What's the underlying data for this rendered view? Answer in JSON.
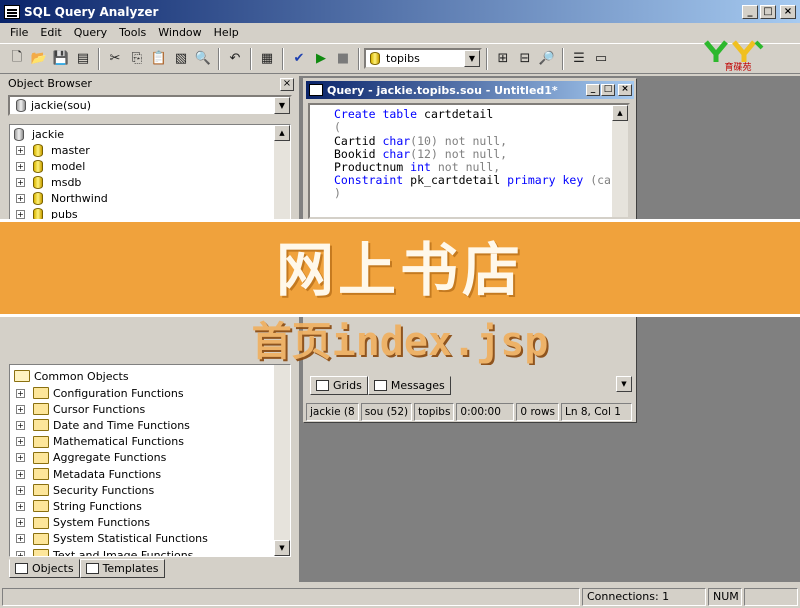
{
  "window": {
    "title": "SQL Query Analyzer",
    "controls": [
      "_",
      "□",
      "×"
    ]
  },
  "menu": [
    "File",
    "Edit",
    "Query",
    "Tools",
    "Window",
    "Help"
  ],
  "toolbar": {
    "database": "topibs"
  },
  "object_browser": {
    "title": "Object Browser",
    "server": "jackie(sou)",
    "tree_root": "jackie",
    "databases": [
      "master",
      "model",
      "msdb",
      "Northwind",
      "pubs"
    ],
    "common_objects_label": "Common Objects",
    "functions": [
      "Configuration Functions",
      "Cursor Functions",
      "Date and Time Functions",
      "Mathematical Functions",
      "Aggregate Functions",
      "Metadata Functions",
      "Security Functions",
      "String Functions",
      "System Functions",
      "System Statistical Functions",
      "Text and Image Functions"
    ],
    "tabs": {
      "objects": "Objects",
      "templates": "Templates"
    }
  },
  "query_window": {
    "title": "Query - jackie.topibs.sou - Untitled1*",
    "code": {
      "line1_kw": "Create table",
      "line1_name": " cartdetail",
      "line2": "(",
      "line3_name": "Cartid ",
      "line3_type": "char",
      "line3_rest": "(10) not null,",
      "line4_name": "Bookid ",
      "line4_type": "char",
      "line4_rest": "(12) not null,",
      "line5_name": "Productnum ",
      "line5_type": "int",
      "line5_rest": " not null,",
      "line6_kw": "Constraint",
      "line6_name": " pk_cartdetail ",
      "line6_kw2": "primary key",
      "line6_rest": " (ca",
      "line7": ")"
    },
    "result_tabs": {
      "grids": "Grids",
      "messages": "Messages"
    },
    "status": [
      "jackie (8",
      "sou (52)",
      "topibs",
      "0:00:00",
      "0 rows",
      "Ln 8, Col 1"
    ]
  },
  "logo_text": "育碟苑",
  "banner": {
    "title": "网上书店",
    "subtitle": "首页index.jsp"
  },
  "statusbar": {
    "connections": "Connections: 1",
    "num": "NUM"
  }
}
